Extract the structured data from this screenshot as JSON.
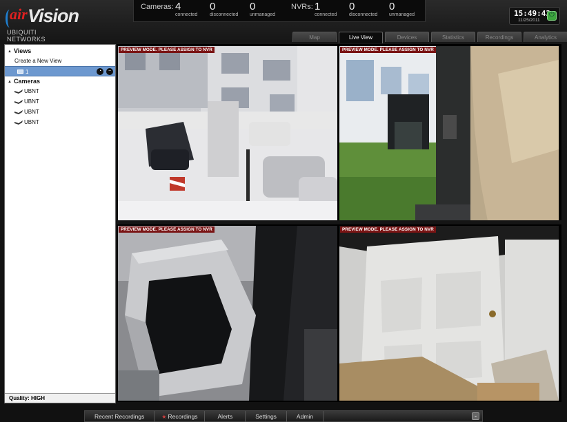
{
  "brand": {
    "logo_air": "air",
    "logo_vision": "Vision",
    "logo_sub": "UBIQUITI NETWORKS"
  },
  "stats": {
    "cameras_label": "Cameras:",
    "cameras_connected": "4",
    "cameras_disconnected": "0",
    "cameras_unmanaged": "0",
    "nvrs_label": "NVRs:",
    "nvrs_connected": "1",
    "nvrs_disconnected": "0",
    "nvrs_unmanaged": "0",
    "connected_label": "connected",
    "disconnected_label": "disconnected",
    "unmanaged_label": "unmanaged"
  },
  "clock": {
    "time": "15:49:43",
    "date": "11/25/2011"
  },
  "tabs": [
    {
      "label": "Map",
      "active": false
    },
    {
      "label": "Live View",
      "active": true
    },
    {
      "label": "Devices",
      "active": false
    },
    {
      "label": "Statistics",
      "active": false
    },
    {
      "label": "Recordings",
      "active": false
    },
    {
      "label": "Analytics",
      "active": false
    }
  ],
  "sidebar": {
    "views_heading": "Views",
    "create_view": "Create a New View",
    "selected_view": "1",
    "cameras_heading": "Cameras",
    "cameras": [
      "UBNT",
      "UBNT",
      "UBNT",
      "UBNT"
    ],
    "quality": "Quality: HIGH"
  },
  "preview_banner": "PREVIEW MODE. PLEASE ASSIGN TO NVR",
  "bottom_tabs": [
    "Recent Recordings",
    "Recordings",
    "Alerts",
    "Settings",
    "Admin"
  ],
  "colors": {
    "banner": "#7a1414",
    "selected_row": "#6d98cf",
    "logo_red": "#e02020",
    "power_green": "#3ea53e"
  }
}
